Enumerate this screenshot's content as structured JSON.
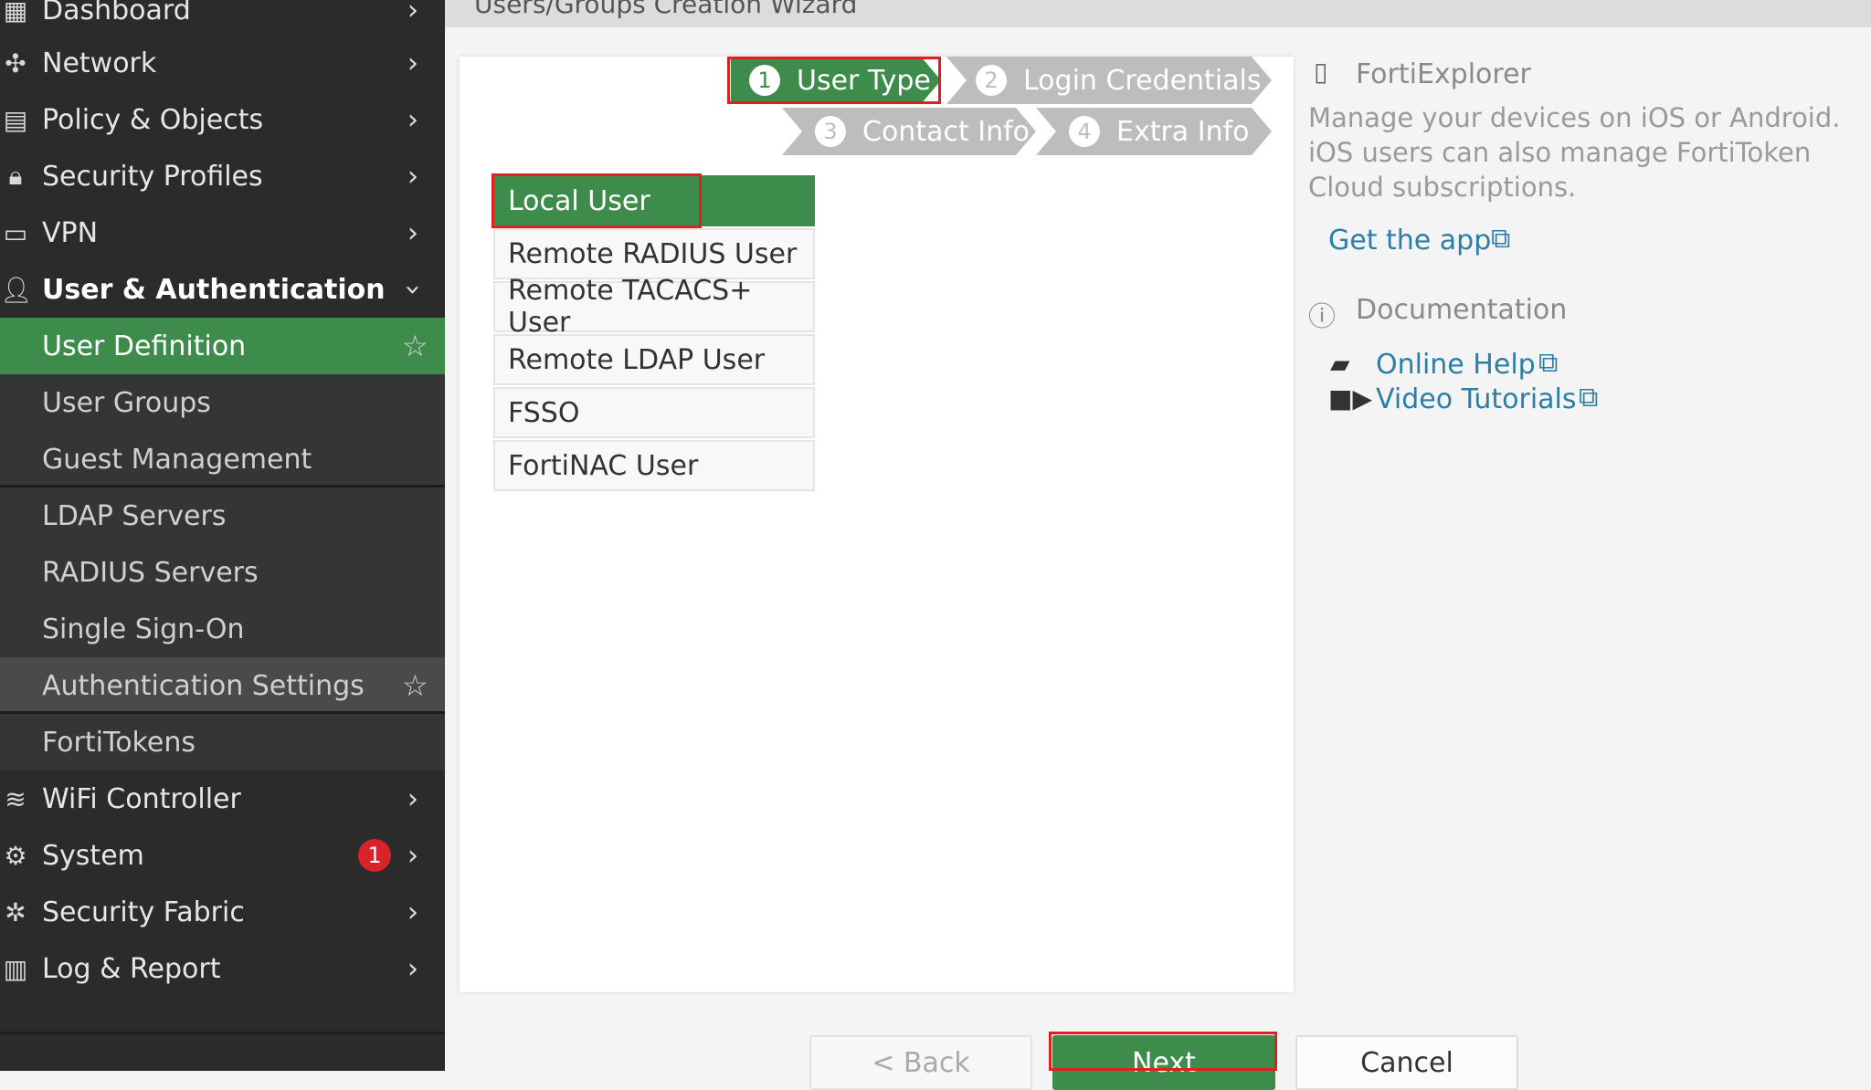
{
  "sidebar": {
    "items": [
      {
        "label": "Dashboard",
        "icon": "dashboard-icon"
      },
      {
        "label": "Network",
        "icon": "network-icon"
      },
      {
        "label": "Policy & Objects",
        "icon": "policy-icon"
      },
      {
        "label": "Security Profiles",
        "icon": "lock-icon"
      },
      {
        "label": "VPN",
        "icon": "vpn-icon"
      },
      {
        "label": "User & Authentication",
        "icon": "user-icon"
      },
      {
        "label": "User Definition"
      },
      {
        "label": "User Groups"
      },
      {
        "label": "Guest Management"
      },
      {
        "label": "LDAP Servers"
      },
      {
        "label": "RADIUS Servers"
      },
      {
        "label": "Single Sign-On"
      },
      {
        "label": "Authentication Settings"
      },
      {
        "label": "FortiTokens"
      },
      {
        "label": "WiFi Controller",
        "icon": "wifi-icon"
      },
      {
        "label": "System",
        "icon": "gear-icon",
        "badge": "1"
      },
      {
        "label": "Security Fabric",
        "icon": "fabric-icon"
      },
      {
        "label": "Log & Report",
        "icon": "chart-icon"
      }
    ]
  },
  "header": {
    "title": "Users/Groups Creation Wizard"
  },
  "wizard": {
    "steps": [
      {
        "num": "1",
        "label": "User Type"
      },
      {
        "num": "2",
        "label": "Login Credentials"
      },
      {
        "num": "3",
        "label": "Contact Info"
      },
      {
        "num": "4",
        "label": "Extra Info"
      }
    ],
    "user_types": [
      "Local User",
      "Remote RADIUS User",
      "Remote TACACS+ User",
      "Remote LDAP User",
      "FSSO",
      "FortiNAC User"
    ],
    "selected_user_type": "Local User"
  },
  "info_panel": {
    "fortiexplorer_title": "FortiExplorer",
    "fortiexplorer_text": "Manage your devices on iOS or Android. iOS users can also manage FortiToken Cloud subscriptions.",
    "get_app": "Get the app",
    "documentation_title": "Documentation",
    "online_help": "Online Help",
    "video_tutorials": "Video Tutorials"
  },
  "buttons": {
    "back": "< Back",
    "next": "Next",
    "cancel": "Cancel"
  },
  "colors": {
    "accent": "#3d8c4c",
    "sidebar_bg": "#2b2b2b",
    "highlight": "#e02020",
    "badge": "#d9232b",
    "link": "#2b7ea6"
  }
}
